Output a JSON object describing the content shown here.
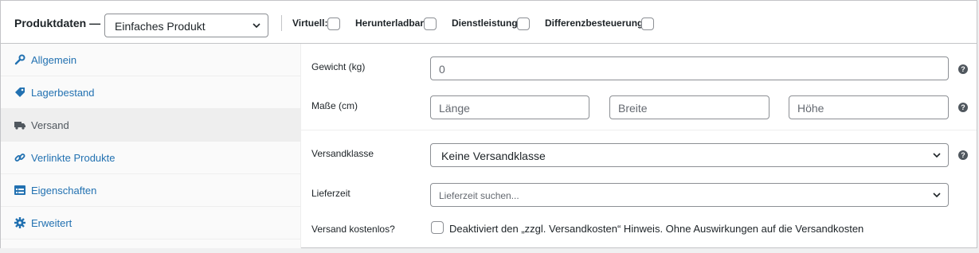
{
  "header": {
    "title": "Produktdaten —",
    "product_type": "Einfaches Produkt",
    "options": [
      {
        "label": "Virtuell:",
        "checked": false
      },
      {
        "label": "Herunterladbar:",
        "checked": false
      },
      {
        "label": "Dienstleistung:",
        "checked": false
      },
      {
        "label": "Differenzbesteuerung:",
        "checked": false
      }
    ]
  },
  "tabs": [
    {
      "label": "Allgemein",
      "icon": "wrench-icon",
      "active": false
    },
    {
      "label": "Lagerbestand",
      "icon": "tag-icon",
      "active": false
    },
    {
      "label": "Versand",
      "icon": "truck-icon",
      "active": true
    },
    {
      "label": "Verlinkte Produkte",
      "icon": "link-icon",
      "active": false
    },
    {
      "label": "Eigenschaften",
      "icon": "list-icon",
      "active": false
    },
    {
      "label": "Erweitert",
      "icon": "gear-icon",
      "active": false
    }
  ],
  "fields": {
    "weight": {
      "label": "Gewicht (kg)",
      "placeholder": "0"
    },
    "dimensions": {
      "label": "Maße (cm)",
      "length_placeholder": "Länge",
      "width_placeholder": "Breite",
      "height_placeholder": "Höhe"
    },
    "shipping_class": {
      "label": "Versandklasse",
      "value": "Keine Versandklasse"
    },
    "delivery_time": {
      "label": "Lieferzeit",
      "placeholder": "Lieferzeit suchen..."
    },
    "free_shipping": {
      "label": "Versand kostenlos?",
      "description": "Deaktiviert den „zzgl. Versandkosten“ Hinweis. Ohne Auswirkungen auf die Versandkosten",
      "checked": false
    }
  },
  "colors": {
    "link": "#2271b1",
    "border": "#8c8f94"
  }
}
